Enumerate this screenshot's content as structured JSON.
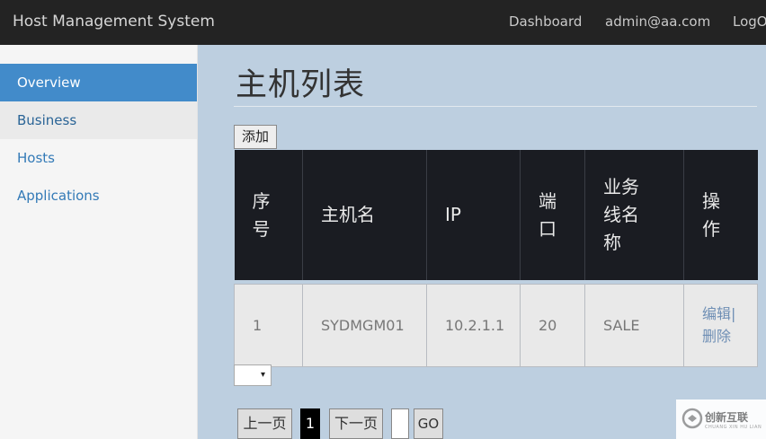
{
  "navbar": {
    "brand": "Host Management System",
    "links": [
      "Dashboard",
      "admin@aa.com",
      "LogOut"
    ]
  },
  "sidebar": {
    "items": [
      {
        "label": "Overview",
        "state": "active"
      },
      {
        "label": "Business",
        "state": "hover"
      },
      {
        "label": "Hosts",
        "state": "normal"
      },
      {
        "label": "Applications",
        "state": "normal"
      }
    ]
  },
  "main": {
    "title": "主机列表",
    "add_label": "添加",
    "table": {
      "headers": [
        [
          "序",
          "号"
        ],
        [
          "主机名"
        ],
        [
          "IP"
        ],
        [
          "端",
          "口"
        ],
        [
          "业务",
          "线名",
          "称"
        ],
        [
          "操",
          "作"
        ]
      ],
      "rows": [
        {
          "index": "1",
          "hostname": "SYDMGM01",
          "ip": "10.2.1.1",
          "port": "20",
          "business": "SALE",
          "edit": "编辑|",
          "delete": "删除"
        }
      ]
    },
    "page_size_select": "▾",
    "pager": {
      "prev": "上一页",
      "current": "1",
      "next": "下一页",
      "go_value": "",
      "go": "GO"
    }
  },
  "watermark": {
    "text": "创新互联",
    "subtext": "CHUANG XIN HU LIAN"
  },
  "colors": {
    "navbar": "#232323",
    "sidebar_active": "#428bca",
    "content_bg": "#bdcfe0",
    "table_header": "#1a1c22"
  }
}
